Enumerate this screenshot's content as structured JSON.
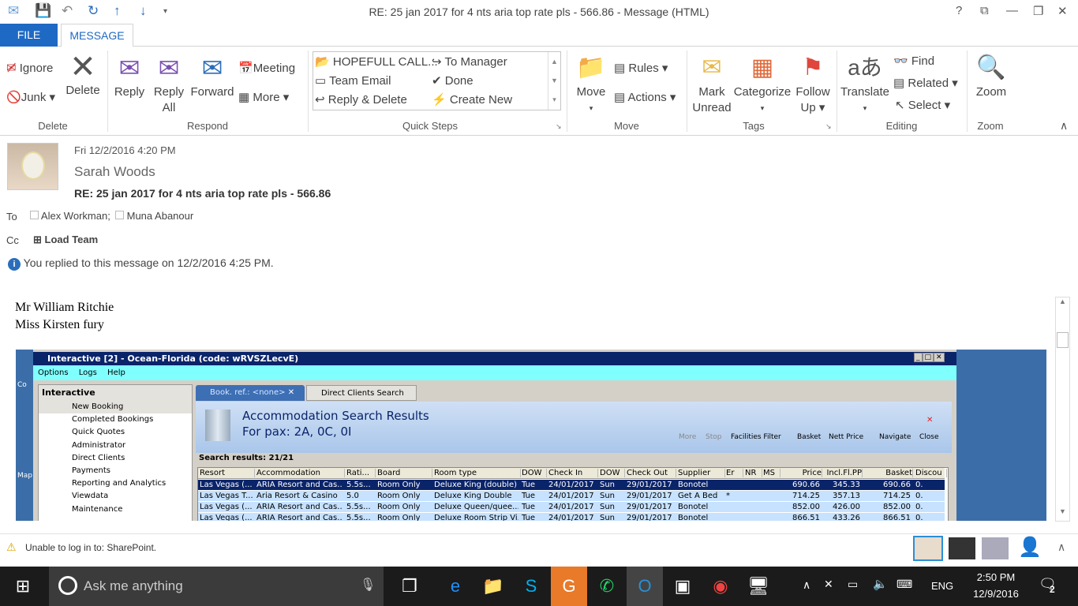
{
  "window": {
    "title": "RE: 25 jan 2017 for 4 nts aria top rate pls - 566.86 - Message (HTML)",
    "help": "?"
  },
  "tabs": {
    "file": "FILE",
    "message": "MESSAGE"
  },
  "ribbon": {
    "delete_group": {
      "label": "Delete",
      "ignore": "Ignore",
      "junk": "Junk",
      "delete": "Delete"
    },
    "respond_group": {
      "label": "Respond",
      "reply": "Reply",
      "reply_all_1": "Reply",
      "reply_all_2": "All",
      "forward": "Forward",
      "meeting": "Meeting",
      "more": "More"
    },
    "quick_steps": {
      "label": "Quick Steps",
      "items": [
        "HOPEFULL CALL...",
        "Team Email",
        "Reply & Delete",
        "To Manager",
        "Done",
        "Create New"
      ]
    },
    "move_group": {
      "label": "Move",
      "move": "Move",
      "rules": "Rules",
      "actions": "Actions"
    },
    "tags_group": {
      "label": "Tags",
      "mark_unread_1": "Mark",
      "mark_unread_2": "Unread",
      "categorize": "Categorize",
      "follow_up_1": "Follow",
      "follow_up_2": "Up"
    },
    "editing_group": {
      "label": "Editing",
      "translate": "Translate",
      "find": "Find",
      "related": "Related",
      "select": "Select"
    },
    "zoom_group": {
      "label": "Zoom",
      "zoom": "Zoom"
    }
  },
  "message": {
    "date": "Fri 12/2/2016 4:20 PM",
    "sender": "Sarah Woods",
    "subject": "RE: 25 jan 2017 for 4 nts aria top rate pls - 566.86",
    "to_label": "To",
    "to": [
      "Alex Workman;",
      "Muna Abanour"
    ],
    "cc_label": "Cc",
    "cc": "Load Team",
    "info": "You replied to this message on 12/2/2016 4:25 PM.",
    "body_lines": [
      "Mr William Ritchie",
      "Miss Kirsten fury"
    ]
  },
  "embedded": {
    "title": "Interactive [2] - Ocean-Florida (code: wRVSZLecvE)",
    "menu": [
      "Options",
      "Logs",
      "Help"
    ],
    "desktop_labels": [
      "Co",
      "Map"
    ],
    "nav_title": "Interactive",
    "nav": [
      "New Booking",
      "Completed Bookings",
      "Quick Quotes",
      "Administrator",
      "Direct Clients",
      "Payments",
      "Reporting and Analytics",
      "Viewdata",
      "Maintenance"
    ],
    "tabs": [
      "Book. ref.: <none>",
      "Direct Clients Search"
    ],
    "heading": "Accommodation Search Results",
    "subheading": "For pax: 2A, 0C, 0I",
    "toolbar": [
      "More",
      "Stop",
      "Facilities Filter",
      "Basket",
      "Nett Price",
      "Navigate",
      "Close"
    ],
    "results": "Search results: 21/21",
    "columns": [
      "Resort",
      "Accommodation",
      "Rati...",
      "Board",
      "Room type",
      "DOW",
      "Check In",
      "DOW",
      "Check Out",
      "Supplier",
      "Er",
      "NR",
      "MS",
      "Price",
      "Incl.Fl.PP",
      "Basket",
      "Discou"
    ],
    "rows": [
      [
        "Las Vegas (...",
        "ARIA Resort and Cas...",
        "5.5s...",
        "Room Only",
        "Deluxe King (double)",
        "Tue",
        "24/01/2017",
        "Sun",
        "29/01/2017",
        "Bonotel",
        "",
        "",
        "",
        "690.66",
        "345.33",
        "690.66",
        "0."
      ],
      [
        "Las Vegas T...",
        "Aria Resort & Casino",
        "5.0",
        "Room Only",
        "Deluxe King Double",
        "Tue",
        "24/01/2017",
        "Sun",
        "29/01/2017",
        "Get A Bed",
        "*",
        "",
        "",
        "714.25",
        "357.13",
        "714.25",
        "0."
      ],
      [
        "Las Vegas (...",
        "ARIA Resort and Cas...",
        "5.5s...",
        "Room Only",
        "Deluxe Queen/quee...",
        "Tue",
        "24/01/2017",
        "Sun",
        "29/01/2017",
        "Bonotel",
        "",
        "",
        "",
        "852.00",
        "426.00",
        "852.00",
        "0."
      ],
      [
        "Las Vegas (...",
        "ARIA Resort and Cas...",
        "5.5s...",
        "Room Only",
        "Deluxe Room Strip Vi...",
        "Tue",
        "24/01/2017",
        "Sun",
        "29/01/2017",
        "Bonotel",
        "",
        "",
        "",
        "866.51",
        "433.26",
        "866.51",
        "0."
      ]
    ]
  },
  "status": {
    "warning": "Unable to log in to: SharePoint."
  },
  "taskbar": {
    "search": "Ask me anything",
    "time": "2:50 PM",
    "date": "12/9/2016",
    "lang": "ENG",
    "notifications": "2"
  },
  "colors": {
    "accent": "#1e69c4",
    "selected_row": "#0a246a",
    "row_bg": "#c6e2ff"
  }
}
